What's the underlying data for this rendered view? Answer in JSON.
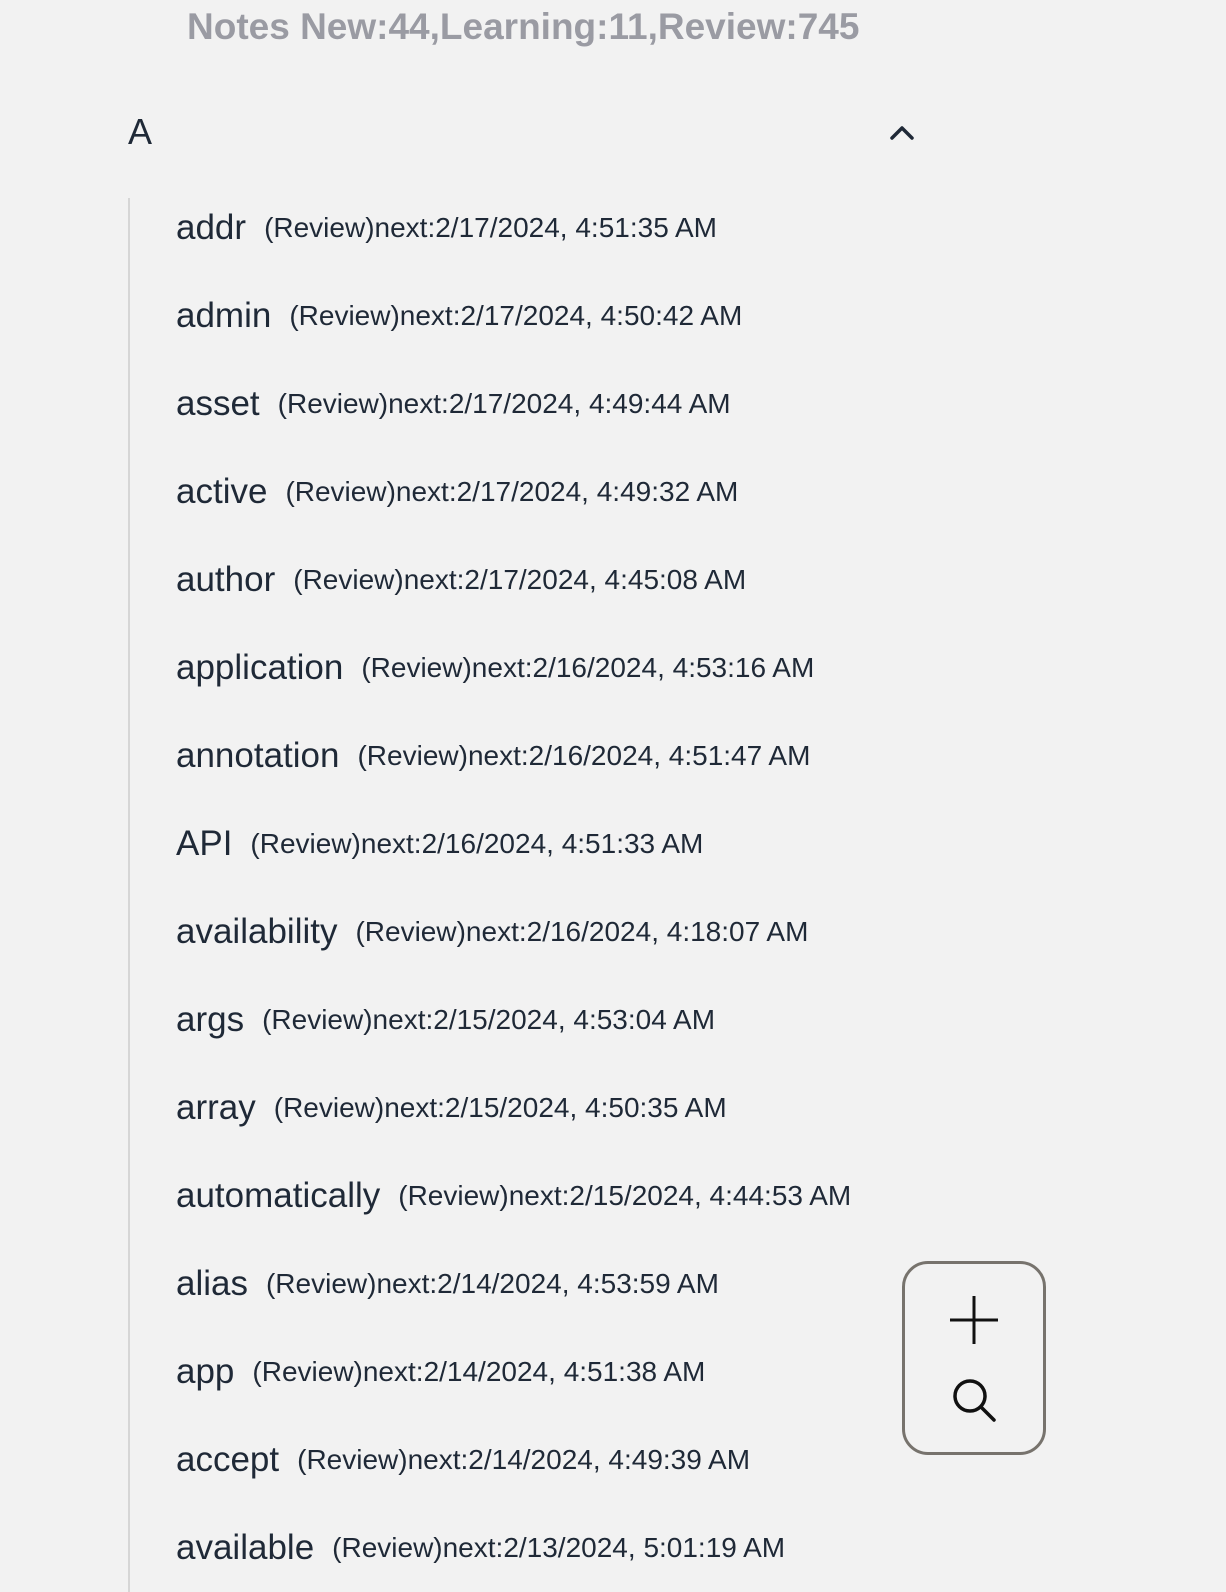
{
  "header": {
    "stats": "Notes New:44,Learning:11,Review:745"
  },
  "section": {
    "letter": "A",
    "collapse_icon": "chevron-up-icon"
  },
  "notes": [
    {
      "word": "addr",
      "meta": "(Review)next:2/17/2024, 4:51:35 AM"
    },
    {
      "word": "admin",
      "meta": "(Review)next:2/17/2024, 4:50:42 AM"
    },
    {
      "word": "asset",
      "meta": "(Review)next:2/17/2024, 4:49:44 AM"
    },
    {
      "word": "active",
      "meta": "(Review)next:2/17/2024, 4:49:32 AM"
    },
    {
      "word": "author",
      "meta": "(Review)next:2/17/2024, 4:45:08 AM"
    },
    {
      "word": "application",
      "meta": "(Review)next:2/16/2024, 4:53:16 AM"
    },
    {
      "word": "annotation",
      "meta": "(Review)next:2/16/2024, 4:51:47 AM"
    },
    {
      "word": "API",
      "meta": "(Review)next:2/16/2024, 4:51:33 AM"
    },
    {
      "word": "availability",
      "meta": "(Review)next:2/16/2024, 4:18:07 AM"
    },
    {
      "word": "args",
      "meta": "(Review)next:2/15/2024, 4:53:04 AM"
    },
    {
      "word": "array",
      "meta": "(Review)next:2/15/2024, 4:50:35 AM"
    },
    {
      "word": "automatically",
      "meta": "(Review)next:2/15/2024, 4:44:53 AM"
    },
    {
      "word": "alias",
      "meta": "(Review)next:2/14/2024, 4:53:59 AM"
    },
    {
      "word": "app",
      "meta": "(Review)next:2/14/2024, 4:51:38 AM"
    },
    {
      "word": "accept",
      "meta": "(Review)next:2/14/2024, 4:49:39 AM"
    },
    {
      "word": "available",
      "meta": "(Review)next:2/13/2024, 5:01:19 AM"
    }
  ],
  "fab": {
    "add_icon": "plus-icon",
    "search_icon": "search-icon"
  },
  "colors": {
    "background": "#f2f2f2",
    "stats_text": "#9a9ba3",
    "text": "#1f2937",
    "panel_border": "#77736d"
  }
}
